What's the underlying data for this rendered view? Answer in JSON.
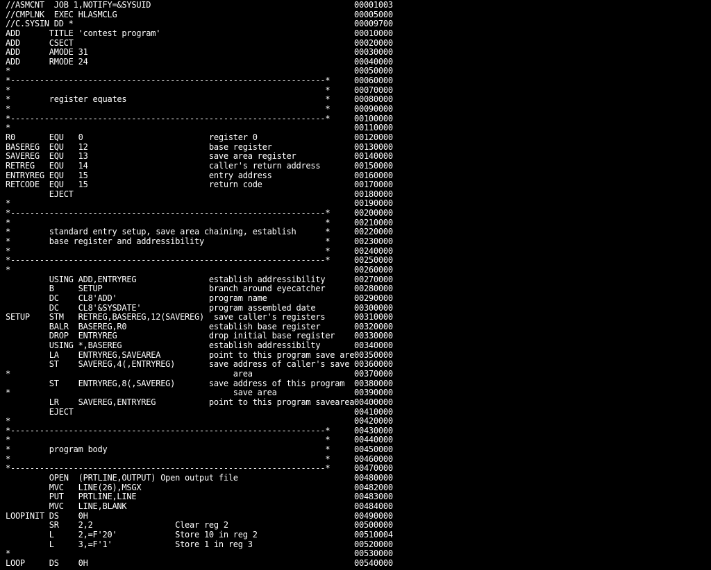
{
  "lines": [
    {
      "code": "//ASMCNT  JOB 1,NOTIFY=&SYSUID",
      "seq": "00001003"
    },
    {
      "code": "//CMPLNK  EXEC HLASMCLG",
      "seq": "00005000"
    },
    {
      "code": "//C.SYSIN DD *",
      "seq": "00009700"
    },
    {
      "code": "ADD      TITLE 'contest program'",
      "seq": "00010000"
    },
    {
      "code": "ADD      CSECT",
      "seq": "00020000"
    },
    {
      "code": "ADD      AMODE 31",
      "seq": "00030000"
    },
    {
      "code": "ADD      RMODE 24",
      "seq": "00040000"
    },
    {
      "code": "*",
      "seq": "00050000"
    },
    {
      "code": "*-----------------------------------------------------------------*",
      "seq": "00060000"
    },
    {
      "code": "*                                                                 *",
      "seq": "00070000"
    },
    {
      "code": "*        register equates                                         *",
      "seq": "00080000"
    },
    {
      "code": "*                                                                 *",
      "seq": "00090000"
    },
    {
      "code": "*-----------------------------------------------------------------*",
      "seq": "00100000"
    },
    {
      "code": "*",
      "seq": "00110000"
    },
    {
      "code": "R0       EQU   0                          register 0",
      "seq": "00120000"
    },
    {
      "code": "BASEREG  EQU   12                         base register",
      "seq": "00130000"
    },
    {
      "code": "SAVEREG  EQU   13                         save area register",
      "seq": "00140000"
    },
    {
      "code": "RETREG   EQU   14                         caller's return address",
      "seq": "00150000"
    },
    {
      "code": "ENTRYREG EQU   15                         entry address",
      "seq": "00160000"
    },
    {
      "code": "RETCODE  EQU   15                         return code",
      "seq": "00170000"
    },
    {
      "code": "         EJECT",
      "seq": "00180000"
    },
    {
      "code": "*",
      "seq": "00190000"
    },
    {
      "code": "*-----------------------------------------------------------------*",
      "seq": "00200000"
    },
    {
      "code": "*                                                                 *",
      "seq": "00210000"
    },
    {
      "code": "*        standard entry setup, save area chaining, establish      *",
      "seq": "00220000"
    },
    {
      "code": "*        base register and addressibility                         *",
      "seq": "00230000"
    },
    {
      "code": "*                                                                 *",
      "seq": "00240000"
    },
    {
      "code": "*-----------------------------------------------------------------*",
      "seq": "00250000"
    },
    {
      "code": "*",
      "seq": "00260000"
    },
    {
      "code": "         USING ADD,ENTRYREG               establish addressibility",
      "seq": "00270000"
    },
    {
      "code": "         B     SETUP                      branch around eyecatcher",
      "seq": "00280000"
    },
    {
      "code": "         DC    CL8'ADD'                   program name",
      "seq": "00290000"
    },
    {
      "code": "         DC    CL8'&SYSDATE'              program assembled date",
      "seq": "00300000"
    },
    {
      "code": "SETUP    STM   RETREG,BASEREG,12(SAVEREG)  save caller's registers",
      "seq": "00310000"
    },
    {
      "code": "         BALR  BASEREG,R0                 establish base register",
      "seq": "00320000"
    },
    {
      "code": "         DROP  ENTRYREG                   drop initial base register",
      "seq": "00330000"
    },
    {
      "code": "         USING *,BASEREG                  establish addressibilty",
      "seq": "00340000"
    },
    {
      "code": "         LA    ENTRYREG,SAVEAREA          point to this program save area",
      "seq": "00350000"
    },
    {
      "code": "         ST    SAVEREG,4(,ENTRYREG)       save address of caller's save",
      "seq": "00360000"
    },
    {
      "code": "*                                              area",
      "seq": "00370000"
    },
    {
      "code": "         ST    ENTRYREG,8(,SAVEREG)       save address of this program",
      "seq": "00380000"
    },
    {
      "code": "*                                              save area",
      "seq": "00390000"
    },
    {
      "code": "         LR    SAVEREG,ENTRYREG           point to this program savearea",
      "seq": "00400000"
    },
    {
      "code": "         EJECT",
      "seq": "00410000"
    },
    {
      "code": "*",
      "seq": "00420000"
    },
    {
      "code": "*-----------------------------------------------------------------*",
      "seq": "00430000"
    },
    {
      "code": "*                                                                 *",
      "seq": "00440000"
    },
    {
      "code": "*        program body                                             *",
      "seq": "00450000"
    },
    {
      "code": "*                                                                 *",
      "seq": "00460000"
    },
    {
      "code": "*-----------------------------------------------------------------*",
      "seq": "00470000"
    },
    {
      "code": "         OPEN  (PRTLINE,OUTPUT) Open output file",
      "seq": "00480000"
    },
    {
      "code": "         MVC   LINE(26),MSGX",
      "seq": "00482000"
    },
    {
      "code": "         PUT   PRTLINE,LINE",
      "seq": "00483000"
    },
    {
      "code": "         MVC   LINE,BLANK",
      "seq": "00484000"
    },
    {
      "code": "LOOPINIT DS    0H",
      "seq": "00490000"
    },
    {
      "code": "         SR    2,2                 Clear reg 2",
      "seq": "00500000"
    },
    {
      "code": "         L     2,=F'20'            Store 10 in reg 2",
      "seq": "00510004"
    },
    {
      "code": "         L     3,=F'1'             Store 1 in reg 3",
      "seq": "00520000"
    },
    {
      "code": "*",
      "seq": "00530000"
    },
    {
      "code": "LOOP     DS    0H",
      "seq": "00540000"
    }
  ]
}
